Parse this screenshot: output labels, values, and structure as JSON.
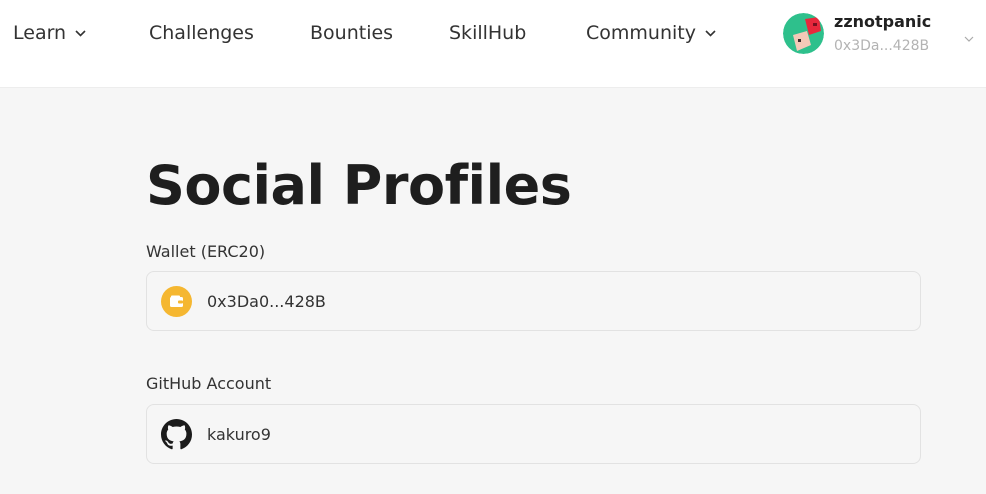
{
  "nav": {
    "items": [
      {
        "label": "Learn",
        "has_dropdown": true
      },
      {
        "label": "Challenges",
        "has_dropdown": false
      },
      {
        "label": "Bounties",
        "has_dropdown": false
      },
      {
        "label": "SkillHub",
        "has_dropdown": false
      },
      {
        "label": "Community",
        "has_dropdown": true
      }
    ]
  },
  "profile": {
    "username": "zznotpanic",
    "address_short": "0x3Da...428B",
    "avatar_icon": "avatar-icon"
  },
  "page": {
    "title": "Social Profiles"
  },
  "fields": {
    "wallet": {
      "label": "Wallet (ERC20)",
      "value": "0x3Da0...428B",
      "icon": "wallet-icon",
      "icon_color": "#f5b731"
    },
    "github": {
      "label": "GitHub Account",
      "value": "kakuro9",
      "icon": "github-icon"
    }
  },
  "colors": {
    "background": "#f6f6f6",
    "topbar": "#ffffff",
    "avatar_bg": "#2ec08c",
    "avatar_accent": "#e8283c"
  }
}
